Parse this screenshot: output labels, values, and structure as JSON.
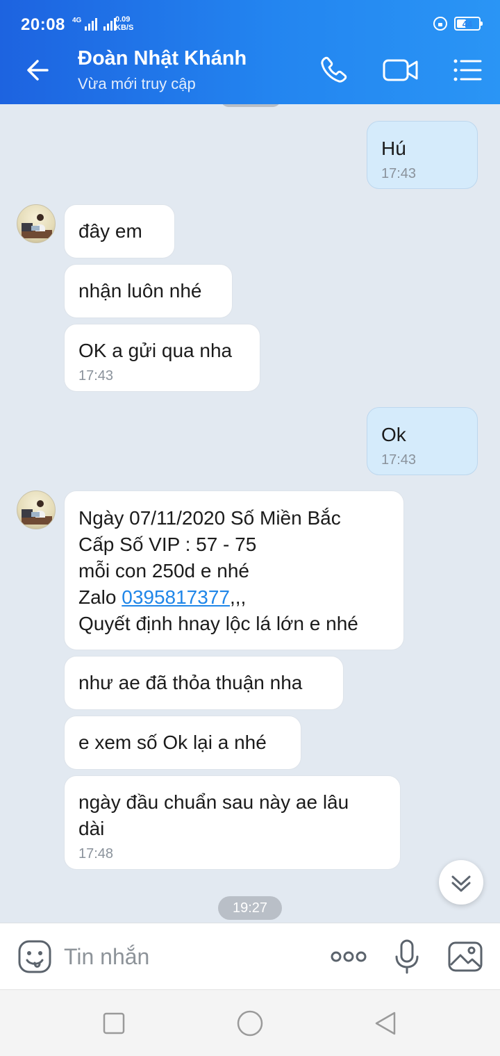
{
  "status_bar": {
    "time": "20:08",
    "network_tag": "4G",
    "speed_value": "0.09",
    "speed_unit": "KB/S",
    "battery": "44",
    "battery_level": 0.44
  },
  "header": {
    "contact_name": "Đoàn Nhật Khánh",
    "status": "Vừa mới truy cập",
    "icons": [
      "back-arrow-icon",
      "phone-icon",
      "video-call-icon",
      "menu-list-icon"
    ]
  },
  "messages": [
    {
      "dir": "out",
      "text": "Hú",
      "time": "17:43"
    },
    {
      "dir": "in",
      "text": "đây em"
    },
    {
      "dir": "in",
      "text": "nhận luôn nhé"
    },
    {
      "dir": "in",
      "text": "OK a gửi qua nha",
      "time": "17:43"
    },
    {
      "dir": "out",
      "text": "Ok",
      "time": "17:43"
    },
    {
      "dir": "in",
      "line1": "Ngày 07/11/2020 Số Miền Bắc",
      "line2": "Cấp Số VIP : 57 - 75",
      "line3": "mỗi con 250d e nhé",
      "line4_prefix": "Zalo ",
      "line4_link": "0395817377",
      "line4_suffix": ",,,",
      "line5": "Quyết định hnay lộc lá lớn e nhé"
    },
    {
      "dir": "in",
      "text": "như ae đã thỏa thuận nha"
    },
    {
      "dir": "in",
      "text": "e xem số Ok lại a nhé"
    },
    {
      "dir": "in",
      "text": "ngày đầu chuẩn sau này ae lâu\ndài",
      "time": "17:48"
    }
  ],
  "timestamp_pill": "19:27",
  "input": {
    "placeholder": "Tin nhắn",
    "icons": [
      "emoji-icon",
      "more-options-icon",
      "microphone-icon",
      "image-icon"
    ]
  },
  "nav_icons": [
    "recent-apps-icon",
    "home-icon",
    "back-icon"
  ],
  "colors": {
    "header_start": "#1d63e0",
    "header_end": "#2a95f5",
    "chat_background": "#e2e9f1",
    "outgoing_bubble": "#d5ebfb",
    "incoming_bubble": "#ffffff",
    "link": "#1f86e8"
  }
}
